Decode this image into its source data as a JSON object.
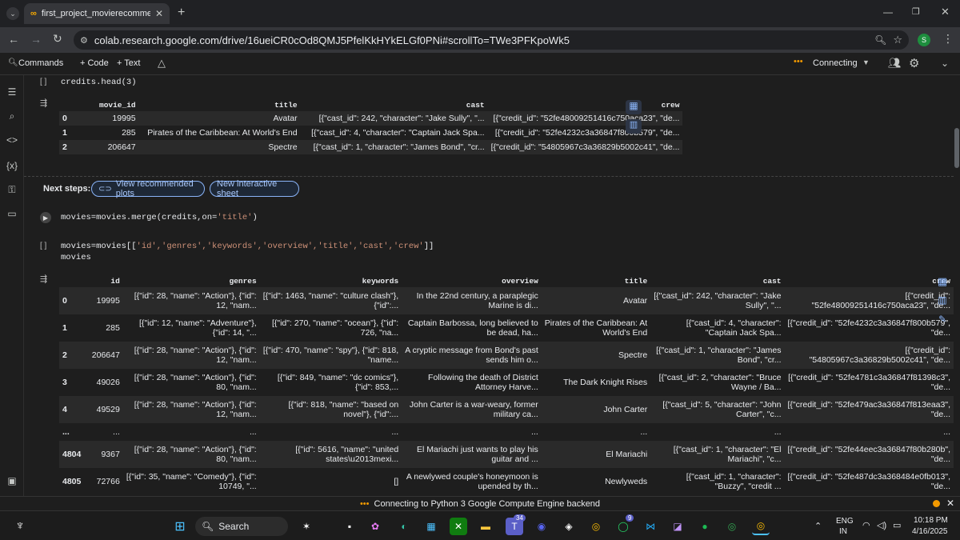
{
  "browser": {
    "tab_title": "first_project_movierecommend",
    "url": "colab.research.google.com/drive/16ueiCR0cOd8QMJ5PfelKkHYkELGf0PNi#scrollTo=TWe3PFKpoWk5",
    "profile_initial": "S"
  },
  "colab": {
    "commands": "Commands",
    "code": "+ Code",
    "text": "+ Text",
    "connecting": "Connecting"
  },
  "cell1": {
    "code": "credits.head(3)",
    "columns": [
      "movie_id",
      "title",
      "cast",
      "crew"
    ],
    "rows": [
      {
        "idx": "0",
        "movie_id": "19995",
        "title": "Avatar",
        "cast": "[{\"cast_id\": 242, \"character\": \"Jake Sully\", \"...",
        "crew": "[{\"credit_id\": \"52fe48009251416c750aca23\", \"de..."
      },
      {
        "idx": "1",
        "movie_id": "285",
        "title": "Pirates of the Caribbean: At World's End",
        "cast": "[{\"cast_id\": 4, \"character\": \"Captain Jack Spa...",
        "crew": "[{\"credit_id\": \"52fe4232c3a36847f800b579\", \"de..."
      },
      {
        "idx": "2",
        "movie_id": "206647",
        "title": "Spectre",
        "cast": "[{\"cast_id\": 1, \"character\": \"James Bond\", \"cr...",
        "crew": "[{\"credit_id\": \"54805967c3a36829b5002c41\", \"de..."
      }
    ],
    "next_steps": "Next steps:",
    "btn_plots": "View recommended plots",
    "btn_sheet": "New interactive sheet"
  },
  "cell2": {
    "code_a": "movies=movies.merge(credits,on=",
    "code_b": "'title'",
    "code_c": ")"
  },
  "cell3": {
    "line1_a": "movies=movies[[",
    "line1_b": "'id','genres','keywords','overview','title','cast','crew'",
    "line1_c": "]]",
    "line2": "movies",
    "columns": [
      "id",
      "genres",
      "keywords",
      "overview",
      "title",
      "cast",
      "crew"
    ],
    "rows": [
      {
        "idx": "0",
        "id": "19995",
        "genres": [
          "[{\"id\": 28, \"name\": \"Action\"}, {\"id\":",
          "12, \"nam..."
        ],
        "keywords": [
          "[{\"id\": 1463, \"name\": \"culture clash\"},",
          "{\"id\":..."
        ],
        "overview": [
          "In the 22nd century, a paraplegic",
          "Marine is di..."
        ],
        "title": [
          "Avatar"
        ],
        "cast": [
          "[{\"cast_id\": 242, \"character\": \"Jake",
          "Sully\", \"..."
        ],
        "crew": [
          "[{\"credit_id\":",
          "\"52fe48009251416c750aca23\", \"de..."
        ]
      },
      {
        "idx": "1",
        "id": "285",
        "genres": [
          "[{\"id\": 12, \"name\": \"Adventure\"},",
          "{\"id\": 14, \"..."
        ],
        "keywords": [
          "[{\"id\": 270, \"name\": \"ocean\"}, {\"id\":",
          "726, \"na..."
        ],
        "overview": [
          "Captain Barbossa, long believed to",
          "be dead, ha..."
        ],
        "title": [
          "Pirates of the Caribbean: At",
          "World's End"
        ],
        "cast": [
          "[{\"cast_id\": 4, \"character\":",
          "\"Captain Jack Spa..."
        ],
        "crew": [
          "[{\"credit_id\": \"52fe4232c3a36847f800b579\",",
          "\"de..."
        ]
      },
      {
        "idx": "2",
        "id": "206647",
        "genres": [
          "[{\"id\": 28, \"name\": \"Action\"}, {\"id\":",
          "12, \"nam..."
        ],
        "keywords": [
          "[{\"id\": 470, \"name\": \"spy\"}, {\"id\": 818,",
          "\"name..."
        ],
        "overview": [
          "A cryptic message from Bond's past",
          "sends him o..."
        ],
        "title": [
          "Spectre"
        ],
        "cast": [
          "[{\"cast_id\": 1, \"character\": \"James",
          "Bond\", \"cr..."
        ],
        "crew": [
          "[{\"credit_id\":",
          "\"54805967c3a36829b5002c41\", \"de..."
        ]
      },
      {
        "idx": "3",
        "id": "49026",
        "genres": [
          "[{\"id\": 28, \"name\": \"Action\"}, {\"id\":",
          "80, \"nam..."
        ],
        "keywords": [
          "[{\"id\": 849, \"name\": \"dc comics\"},",
          "{\"id\": 853,..."
        ],
        "overview": [
          "Following the death of District",
          "Attorney Harve..."
        ],
        "title": [
          "The Dark Knight Rises"
        ],
        "cast": [
          "[{\"cast_id\": 2, \"character\": \"Bruce",
          "Wayne / Ba..."
        ],
        "crew": [
          "[{\"credit_id\": \"52fe4781c3a36847f81398c3\",",
          "\"de..."
        ]
      },
      {
        "idx": "4",
        "id": "49529",
        "genres": [
          "[{\"id\": 28, \"name\": \"Action\"}, {\"id\":",
          "12, \"nam..."
        ],
        "keywords": [
          "[{\"id\": 818, \"name\": \"based on",
          "novel\"}, {\"id\":..."
        ],
        "overview": [
          "John Carter is a war-weary, former",
          "military ca..."
        ],
        "title": [
          "John Carter"
        ],
        "cast": [
          "[{\"cast_id\": 5, \"character\": \"John",
          "Carter\", \"c..."
        ],
        "crew": [
          "[{\"credit_id\": \"52fe479ac3a36847f813eaa3\",",
          "\"de..."
        ]
      },
      {
        "idx": "...",
        "id": "...",
        "genres": [
          "..."
        ],
        "keywords": [
          "..."
        ],
        "overview": [
          "..."
        ],
        "title": [
          "..."
        ],
        "cast": [
          "..."
        ],
        "crew": [
          "..."
        ]
      },
      {
        "idx": "4804",
        "id": "9367",
        "genres": [
          "[{\"id\": 28, \"name\": \"Action\"}, {\"id\":",
          "80, \"nam..."
        ],
        "keywords": [
          "[{\"id\": 5616, \"name\": \"united",
          "states\\u2013mexi..."
        ],
        "overview": [
          "El Mariachi just wants to play his",
          "guitar and ..."
        ],
        "title": [
          "El Mariachi"
        ],
        "cast": [
          "[{\"cast_id\": 1, \"character\": \"El",
          "Mariachi\", \"c..."
        ],
        "crew": [
          "[{\"credit_id\": \"52fe44eec3a36847f80b280b\",",
          "\"de..."
        ]
      },
      {
        "idx": "4805",
        "id": "72766",
        "genres": [
          "[{\"id\": 35, \"name\": \"Comedy\"}, {\"id\":",
          "10749, \"..."
        ],
        "keywords": [
          "[]"
        ],
        "overview": [
          "A newlywed couple's honeymoon is",
          "upended by th..."
        ],
        "title": [
          "Newlyweds"
        ],
        "cast": [
          "[{\"cast_id\": 1, \"character\":",
          "\"Buzzy\", \"credit ..."
        ],
        "crew": [
          "[{\"credit_id\": \"52fe487dc3a368484e0fb013\",",
          "\"de..."
        ]
      }
    ]
  },
  "status": {
    "dots": "•••",
    "text": "Connecting to Python 3 Google Compute Engine backend"
  },
  "taskbar": {
    "search": "Search",
    "lang1": "ENG",
    "lang2": "IN",
    "time": "10:18 PM",
    "date": "4/16/2025",
    "badge_teams": "34",
    "badge_whatsapp": "9"
  },
  "colors": {
    "accent": "#8ab4f8",
    "status_dot": "#f29900"
  }
}
